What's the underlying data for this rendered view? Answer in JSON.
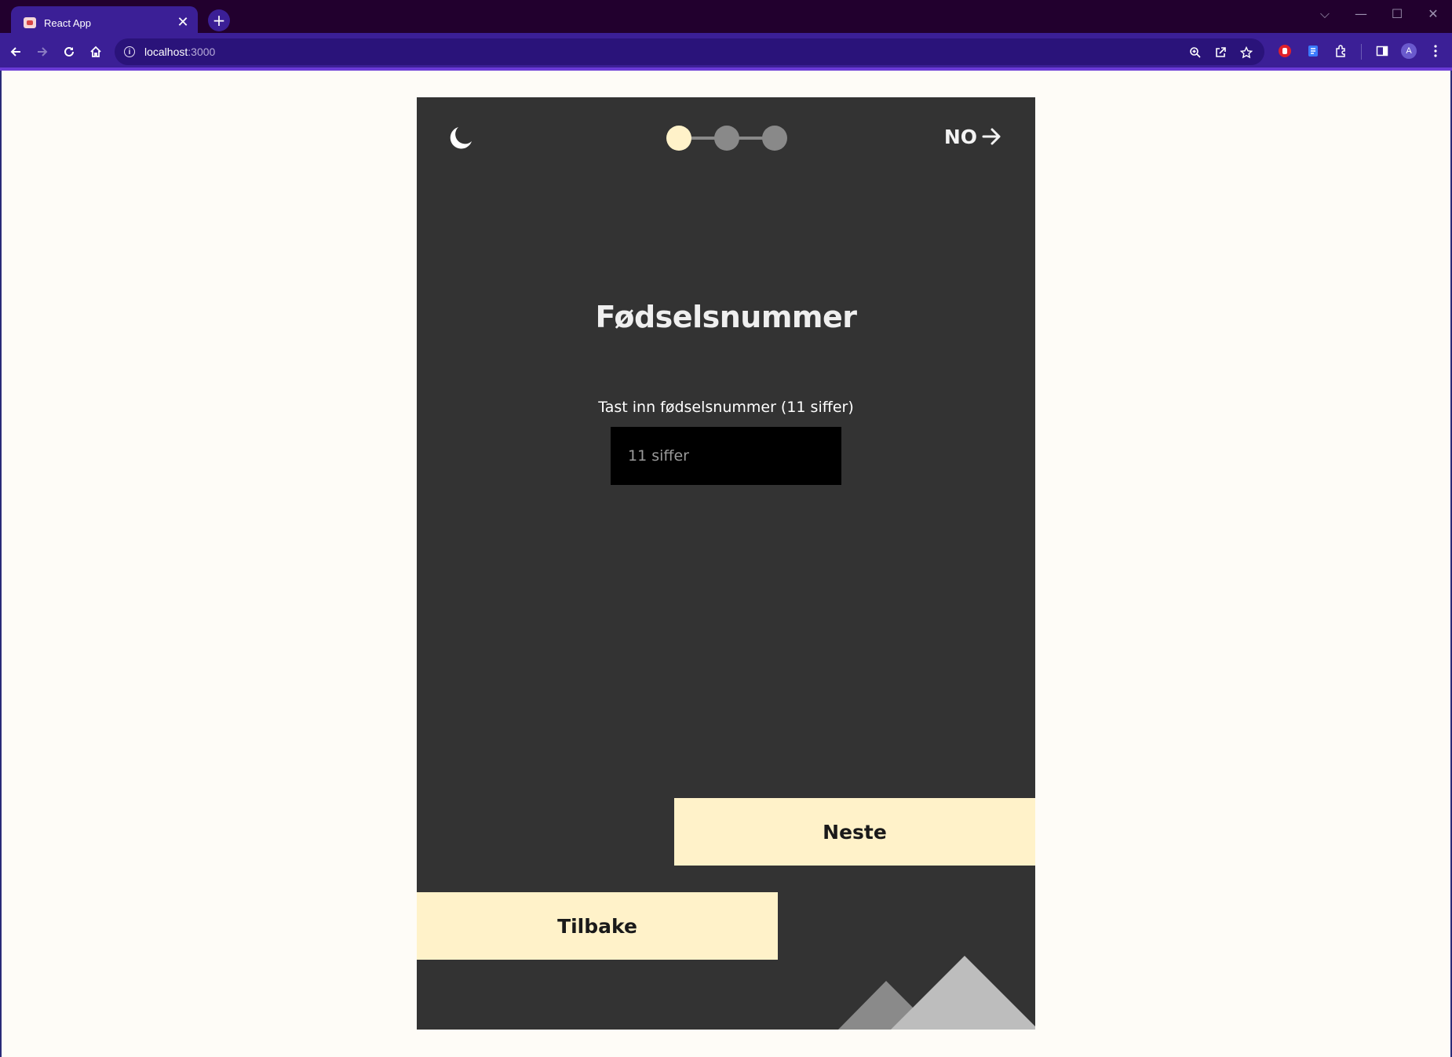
{
  "browser": {
    "tab_title": "React App",
    "tab_close": "✕",
    "new_tab": "+",
    "url_host": "localhost",
    "url_port": ":3000",
    "profile_initial": "A",
    "window_controls": {
      "collapse": "⌵",
      "minimize": "—",
      "maximize": "☐",
      "close": "✕"
    }
  },
  "app": {
    "theme_icon": "moon-icon",
    "stepper": {
      "total_steps": 3,
      "current_step": 1,
      "active_color": "#fff2c9",
      "inactive_color": "#898989"
    },
    "language_label": "NO",
    "title": "Fødselsnummer",
    "field": {
      "label": "Tast inn fødselsnummer (11 siffer)",
      "placeholder": "11 siffer",
      "value": ""
    },
    "buttons": {
      "next": "Neste",
      "back": "Tilbake"
    },
    "colors": {
      "panel": "#333333",
      "button": "#fff2c9",
      "page_background": "#fefcf7"
    }
  }
}
